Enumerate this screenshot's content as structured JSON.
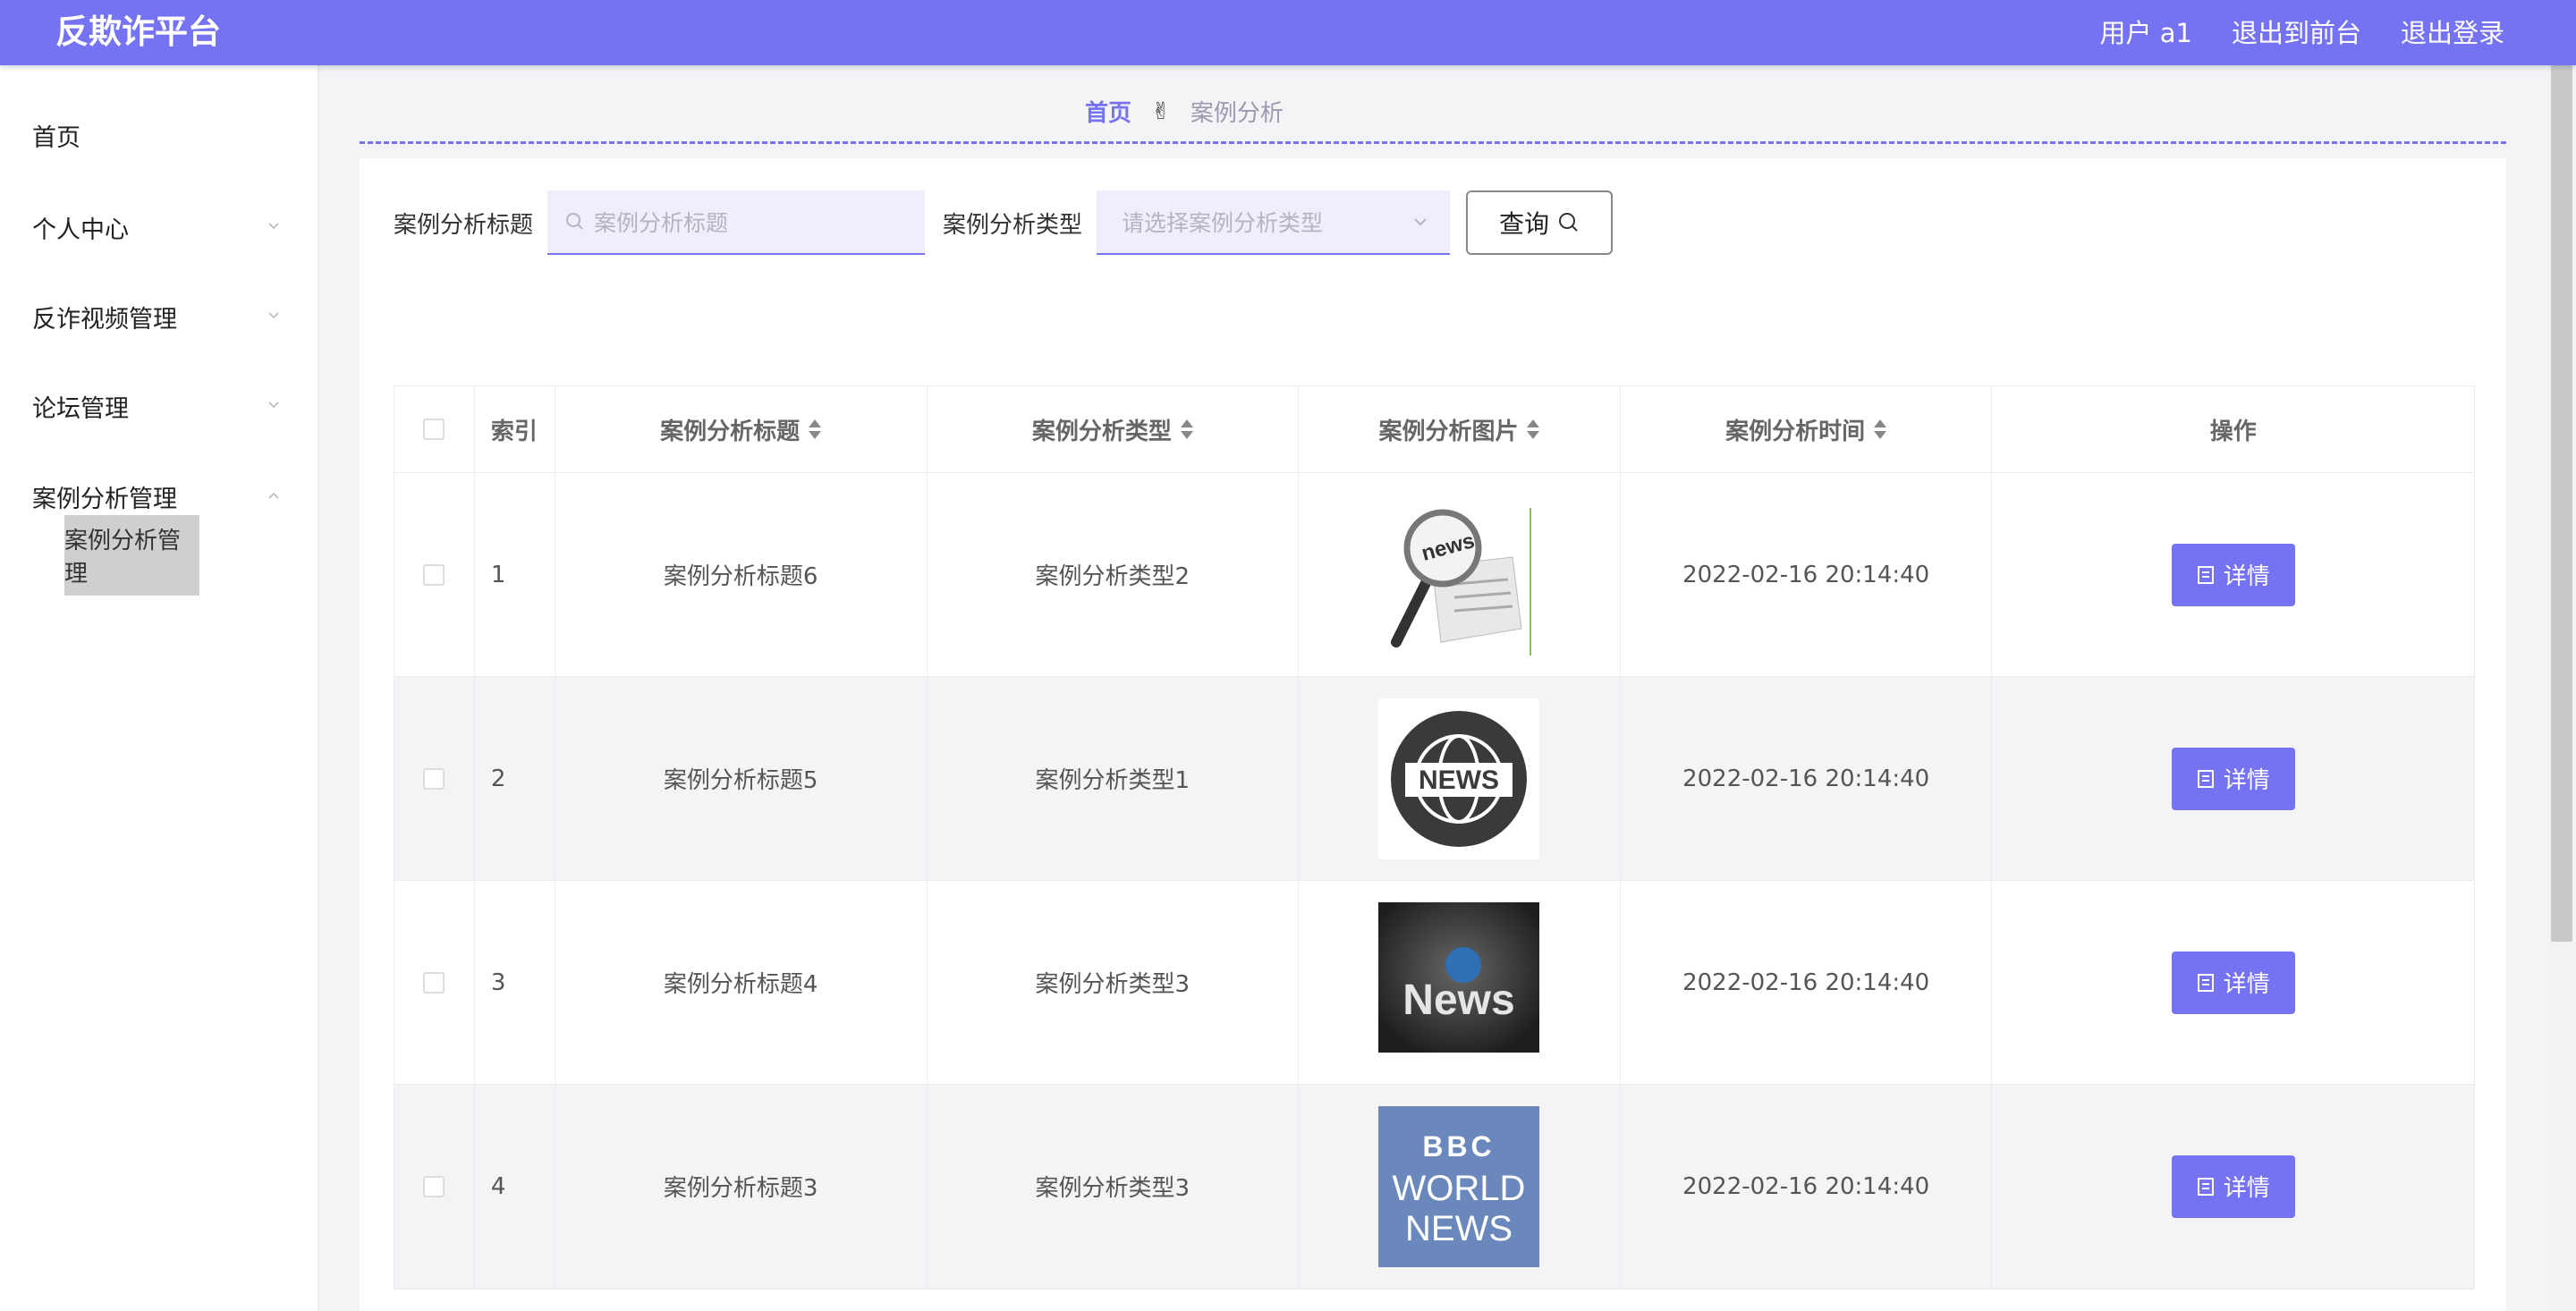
{
  "header": {
    "brand": "反欺诈平台",
    "nav": [
      "用户 a1",
      "退出到前台",
      "退出登录"
    ]
  },
  "sidebar": {
    "items": [
      {
        "label": "首页"
      },
      {
        "label": "个人中心"
      },
      {
        "label": "反诈视频管理"
      },
      {
        "label": "论坛管理"
      },
      {
        "label": "案例分析管理"
      }
    ],
    "sub_item": "案例分析管理"
  },
  "breadcrumb": {
    "home": "首页",
    "sep": "✌",
    "current": "案例分析"
  },
  "search": {
    "title_label": "案例分析标题",
    "title_placeholder": "案例分析标题",
    "type_label": "案例分析类型",
    "type_placeholder": "请选择案例分析类型",
    "query_button": "查询"
  },
  "table": {
    "headers": [
      "索引",
      "案例分析标题",
      "案例分析类型",
      "案例分析图片",
      "案例分析时间",
      "操作"
    ],
    "rows": [
      {
        "index": "1",
        "title": "案例分析标题6",
        "type": "案例分析类型2",
        "image": "news-magnifier",
        "time": "2022-02-16 20:14:40",
        "action": "详情"
      },
      {
        "index": "2",
        "title": "案例分析标题5",
        "type": "案例分析类型1",
        "image": "news-globe",
        "time": "2022-02-16 20:14:40",
        "action": "详情"
      },
      {
        "index": "3",
        "title": "案例分析标题4",
        "type": "案例分析类型3",
        "image": "news-dark",
        "time": "2022-02-16 20:14:40",
        "action": "详情"
      },
      {
        "index": "4",
        "title": "案例分析标题3",
        "type": "案例分析类型3",
        "image": "bbc-world-news",
        "time": "2022-02-16 20:14:40",
        "action": "详情"
      }
    ]
  },
  "thumb_text": {
    "news_lower": "news",
    "news_upper": "NEWS",
    "news_mixed": "News",
    "bbc": "BBC",
    "world": "WORLD",
    "news": "NEWS"
  }
}
